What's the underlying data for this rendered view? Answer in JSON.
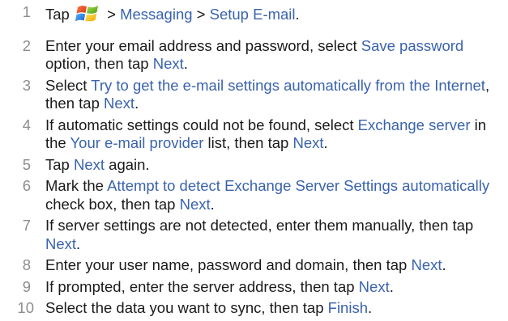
{
  "steps": [
    {
      "number": "1",
      "segments": [
        {
          "text": "Tap ",
          "link": false
        },
        {
          "icon": "windows-start-icon"
        },
        {
          "text": " > ",
          "link": false
        },
        {
          "text": "Messaging",
          "link": true
        },
        {
          "text": " > ",
          "link": false
        },
        {
          "text": "Setup E-mail",
          "link": true
        },
        {
          "text": ".",
          "link": false
        }
      ]
    },
    {
      "number": "2",
      "segments": [
        {
          "text": "Enter your email address and password, select ",
          "link": false
        },
        {
          "text": "Save password",
          "link": true
        },
        {
          "text": " option, then tap ",
          "link": false
        },
        {
          "text": "Next",
          "link": true
        },
        {
          "text": ".",
          "link": false
        }
      ]
    },
    {
      "number": "3",
      "segments": [
        {
          "text": "Select ",
          "link": false
        },
        {
          "text": "Try to get the e-mail settings automatically from the Internet",
          "link": true
        },
        {
          "text": ", then tap ",
          "link": false
        },
        {
          "text": "Next",
          "link": true
        },
        {
          "text": ".",
          "link": false
        }
      ]
    },
    {
      "number": "4",
      "segments": [
        {
          "text": "If automatic settings could not be found, select ",
          "link": false
        },
        {
          "text": "Exchange server",
          "link": true
        },
        {
          "text": " in the ",
          "link": false
        },
        {
          "text": "Your e-mail provider",
          "link": true
        },
        {
          "text": " list, then tap ",
          "link": false
        },
        {
          "text": "Next",
          "link": true
        },
        {
          "text": ".",
          "link": false
        }
      ]
    },
    {
      "number": "5",
      "segments": [
        {
          "text": "Tap ",
          "link": false
        },
        {
          "text": "Next",
          "link": true
        },
        {
          "text": " again.",
          "link": false
        }
      ]
    },
    {
      "number": "6",
      "segments": [
        {
          "text": "Mark the ",
          "link": false
        },
        {
          "text": "Attempt to detect Exchange Server Settings automatically",
          "link": true
        },
        {
          "text": " check box, then tap ",
          "link": false
        },
        {
          "text": "Next",
          "link": true
        },
        {
          "text": ".",
          "link": false
        }
      ]
    },
    {
      "number": "7",
      "segments": [
        {
          "text": "If server settings are not detected, enter them manually, then tap ",
          "link": false
        },
        {
          "text": "Next",
          "link": true
        },
        {
          "text": ".",
          "link": false
        }
      ]
    },
    {
      "number": "8",
      "segments": [
        {
          "text": "Enter your user name, password and domain, then tap ",
          "link": false
        },
        {
          "text": "Next",
          "link": true
        },
        {
          "text": ".",
          "link": false
        }
      ]
    },
    {
      "number": "9",
      "segments": [
        {
          "text": "If prompted, enter the server address, then tap ",
          "link": false
        },
        {
          "text": "Next",
          "link": true
        },
        {
          "text": ".",
          "link": false
        }
      ]
    },
    {
      "number": "10",
      "segments": [
        {
          "text": "Select the data you want to sync, then tap ",
          "link": false
        },
        {
          "text": "Finish",
          "link": true
        },
        {
          "text": ".",
          "link": false
        }
      ]
    }
  ],
  "colors": {
    "text": "#1a1a1a",
    "link": "#3a63ad",
    "number": "#8d8d8d"
  }
}
